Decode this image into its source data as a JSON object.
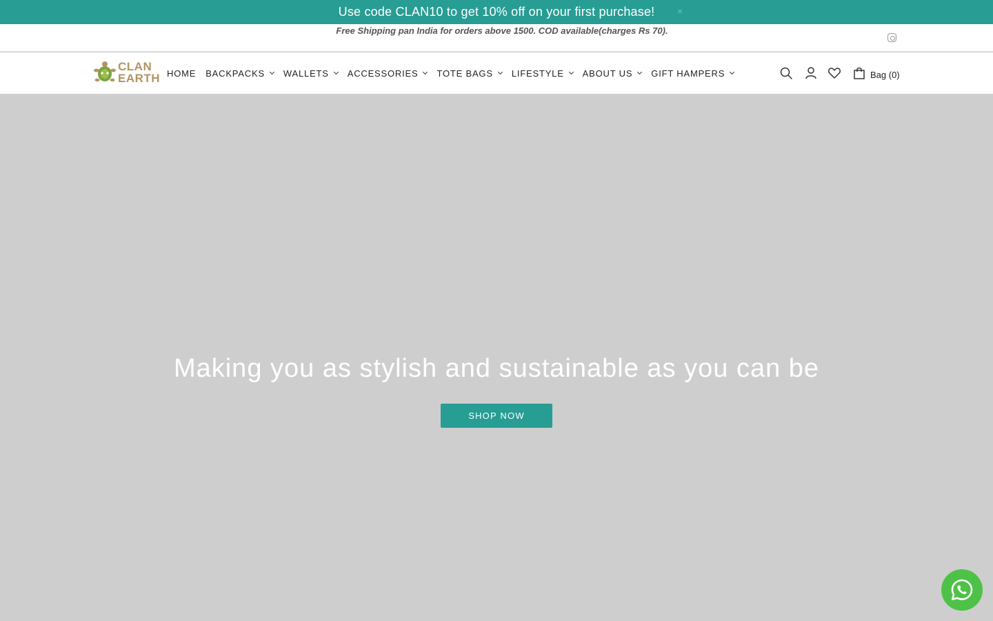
{
  "promo": {
    "text": "Use code CLAN10 to get 10% off on your first purchase!",
    "close": "×"
  },
  "shipping": {
    "text": "Free Shipping pan India for orders above 1500. COD available(charges Rs 70)."
  },
  "logo": {
    "line1": "CLAN",
    "line2": "EARTH"
  },
  "nav": {
    "items": [
      {
        "label": "HOME"
      },
      {
        "label": "BACKPACKS"
      },
      {
        "label": "WALLETS"
      },
      {
        "label": "ACCESSORIES"
      },
      {
        "label": "TOTE BAGS"
      },
      {
        "label": "LIFESTYLE"
      },
      {
        "label": "ABOUT US"
      },
      {
        "label": "GIFT HAMPERS"
      }
    ],
    "bag_label": "Bag (0)"
  },
  "hero": {
    "title": "Making you as stylish and sustainable as you can be",
    "button": "SHOP NOW"
  },
  "colors": {
    "accent": "#279d94",
    "logo": "#b39461",
    "hero_bg": "#cecece",
    "whatsapp": "#4dc247"
  }
}
